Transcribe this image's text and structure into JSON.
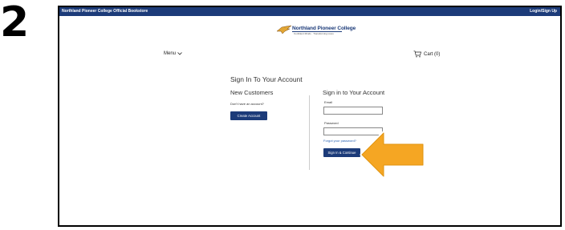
{
  "step": {
    "number": "2"
  },
  "topbar": {
    "site_name": "Northland Pioneer College Official Bookstore",
    "login_link": "Login/Sign Up"
  },
  "logo": {
    "brand": "Northland Pioneer College",
    "tagline": "Confident Minds · Transforming Lives"
  },
  "nav": {
    "menu_label": "Menu",
    "cart_label": "Cart (0)"
  },
  "signin": {
    "heading": "Sign In To Your Account",
    "new_customers": {
      "title": "New Customers",
      "prompt": "Don't have an account?",
      "button": "Create Account"
    },
    "account": {
      "title": "Sign in to Your Account",
      "email_label": "Email",
      "email_value": "",
      "password_label": "Password",
      "password_value": "",
      "forgot_link": "Forgot your password?",
      "submit_button": "Sign In & Continue"
    }
  },
  "colors": {
    "brand": "#1c3b79",
    "arrow": "#f5a623",
    "link": "#2a63b3"
  },
  "icons": {
    "menu": "chevron-down-icon",
    "cart": "cart-icon",
    "pointer": "arrow-left-icon"
  }
}
